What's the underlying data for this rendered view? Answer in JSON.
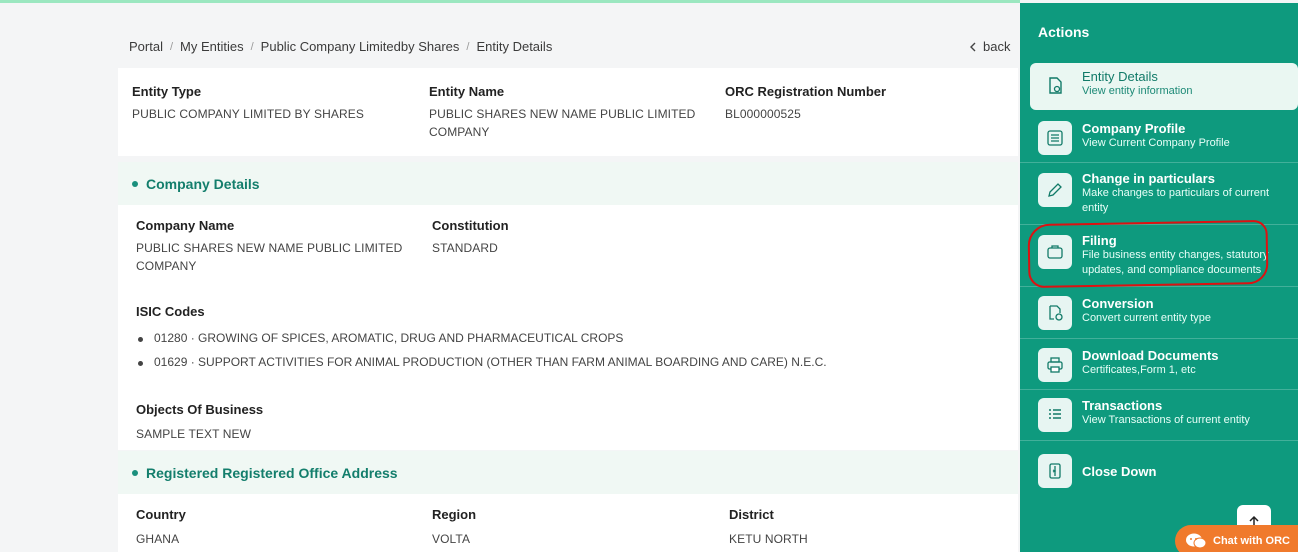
{
  "breadcrumb": {
    "items": [
      "Portal",
      "My Entities",
      "Public Company Limitedby Shares",
      "Entity Details"
    ],
    "back_label": "back"
  },
  "summary": {
    "entity_type_label": "Entity Type",
    "entity_type_value": "PUBLIC COMPANY LIMITED BY SHARES",
    "entity_name_label": "Entity Name",
    "entity_name_value": "PUBLIC SHARES NEW NAME PUBLIC LIMITED COMPANY",
    "orc_label": "ORC Registration Number",
    "orc_value": "BL000000525"
  },
  "company_details": {
    "title": "Company Details",
    "company_name_label": "Company Name",
    "company_name_value": "PUBLIC SHARES NEW NAME PUBLIC LIMITED COMPANY",
    "constitution_label": "Constitution",
    "constitution_value": "STANDARD",
    "isic_label": "ISIC Codes",
    "isic_codes": [
      "01280 · GROWING OF SPICES, AROMATIC, DRUG AND PHARMACEUTICAL CROPS",
      "01629 · SUPPORT ACTIVITIES FOR ANIMAL PRODUCTION (OTHER THAN FARM ANIMAL BOARDING AND CARE) N.E.C."
    ],
    "objects_label": "Objects Of Business",
    "objects_value": "SAMPLE TEXT NEW"
  },
  "office_address": {
    "title": "Registered Registered Office Address",
    "country_label": "Country",
    "country_value": "GHANA",
    "region_label": "Region",
    "region_value": "VOLTA",
    "district_label": "District",
    "district_value": "KETU NORTH"
  },
  "actions": {
    "heading": "Actions",
    "items": [
      {
        "title": "Entity Details",
        "desc": "View entity information",
        "icon": "document-view-icon"
      },
      {
        "title": "Company Profile",
        "desc": "View Current Company Profile",
        "icon": "list-icon"
      },
      {
        "title": "Change in particulars",
        "desc": "Make changes to particulars of current entity",
        "icon": "pencil-icon"
      },
      {
        "title": "Filing",
        "desc": "File business entity changes, statutory updates, and compliance documents",
        "icon": "briefcase-icon"
      },
      {
        "title": "Conversion",
        "desc": "Convert current entity type",
        "icon": "convert-icon"
      },
      {
        "title": "Download Documents",
        "desc": "Certificates,Form 1, etc",
        "icon": "printer-icon"
      },
      {
        "title": "Transactions",
        "desc": "View Transactions of current entity",
        "icon": "transactions-icon"
      },
      {
        "title": "Close Down",
        "desc": "",
        "icon": "close-down-icon"
      }
    ]
  },
  "chat": {
    "label": "Chat with ORC"
  },
  "colors": {
    "accent": "#0e9a7e",
    "highlight": "#dd1111",
    "chat": "#f07a2c"
  }
}
